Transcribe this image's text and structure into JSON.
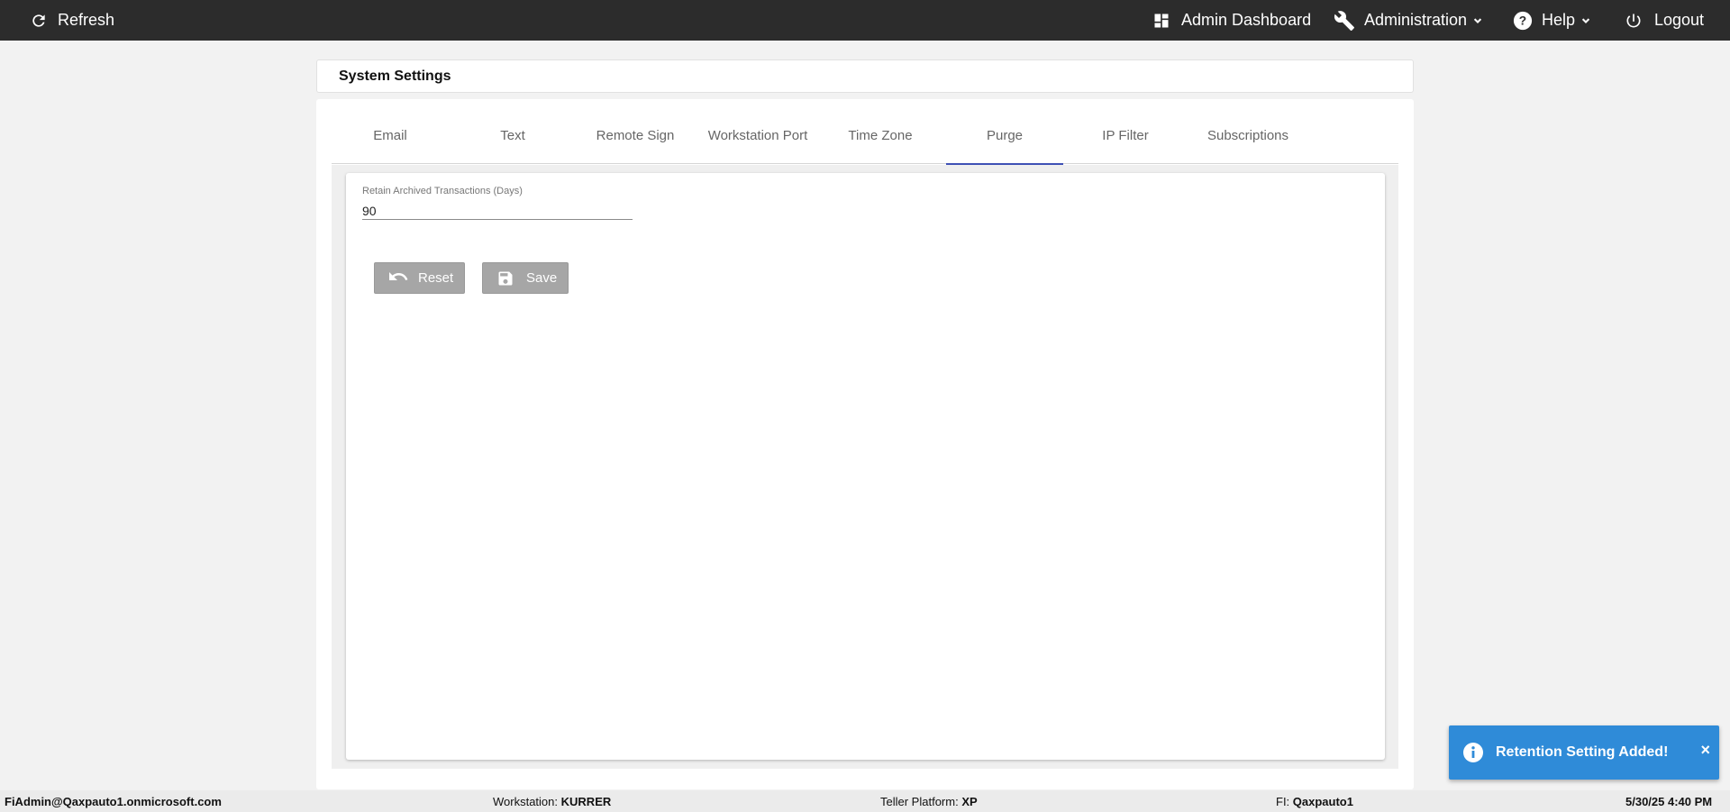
{
  "topbar": {
    "refresh_label": "Refresh",
    "admin_dashboard_label": "Admin Dashboard",
    "administration_label": "Administration",
    "help_label": "Help",
    "logout_label": "Logout"
  },
  "page": {
    "title": "System Settings"
  },
  "tabs": [
    {
      "label": "Email"
    },
    {
      "label": "Text"
    },
    {
      "label": "Remote Sign"
    },
    {
      "label": "Workstation Port"
    },
    {
      "label": "Time Zone"
    },
    {
      "label": "Purge",
      "active": true
    },
    {
      "label": "IP Filter"
    },
    {
      "label": "Subscriptions"
    }
  ],
  "form": {
    "retain_label": "Retain Archived Transactions (Days)",
    "retain_value": "90",
    "reset_label": "Reset",
    "save_label": "Save"
  },
  "toast": {
    "message": "Retention Setting Added!",
    "close": "×"
  },
  "footer": {
    "user": "FiAdmin@Qaxpauto1.onmicrosoft.com",
    "workstation_label": "Workstation:",
    "workstation_value": "KURRER",
    "teller_label": "Teller Platform:",
    "teller_value": "XP",
    "fi_label": "FI:",
    "fi_value": "Qaxpauto1",
    "datetime": "5/30/25 4:40 PM"
  },
  "colors": {
    "topbar": "#2c2c2c",
    "tab_indicator": "#3f51b5",
    "toast": "#2f8bd8",
    "button_disabled": "#a6a6a6"
  }
}
